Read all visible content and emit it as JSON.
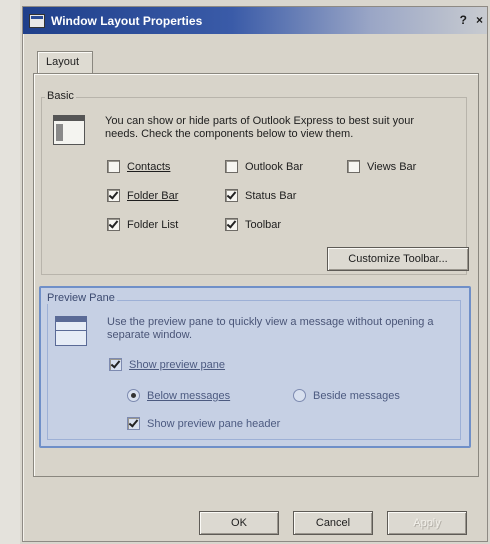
{
  "window": {
    "title": "Window Layout Properties",
    "help_glyph": "?",
    "close_glyph": "×"
  },
  "tabs": [
    {
      "label": "Layout"
    }
  ],
  "basic": {
    "label": "Basic",
    "description": "You can show or hide parts of Outlook Express to best suit your needs. Check the components below to view them.",
    "checkboxes": [
      {
        "label": "Contacts",
        "checked": false
      },
      {
        "label": "Outlook Bar",
        "checked": false
      },
      {
        "label": "Views Bar",
        "checked": false
      },
      {
        "label": "Folder Bar",
        "checked": true
      },
      {
        "label": "Status Bar",
        "checked": true
      },
      {
        "label": "Folder List",
        "checked": true
      },
      {
        "label": "Toolbar",
        "checked": true
      }
    ],
    "customize_label": "Customize Toolbar..."
  },
  "preview": {
    "label": "Preview Pane",
    "description": "Use the preview pane to quickly view a message without opening a separate window.",
    "show_label": "Show preview pane",
    "show_checked": true,
    "below_label": "Below messages",
    "below_selected": true,
    "beside_label": "Beside messages",
    "beside_selected": false,
    "header_label": "Show preview pane header",
    "header_checked": true
  },
  "buttons": {
    "ok": "OK",
    "cancel": "Cancel",
    "apply": "Apply"
  },
  "colors": {
    "titlebar": "#1f3f8a",
    "highlight_box": "#c6d0e4",
    "highlight_border": "#6f8fc8"
  }
}
